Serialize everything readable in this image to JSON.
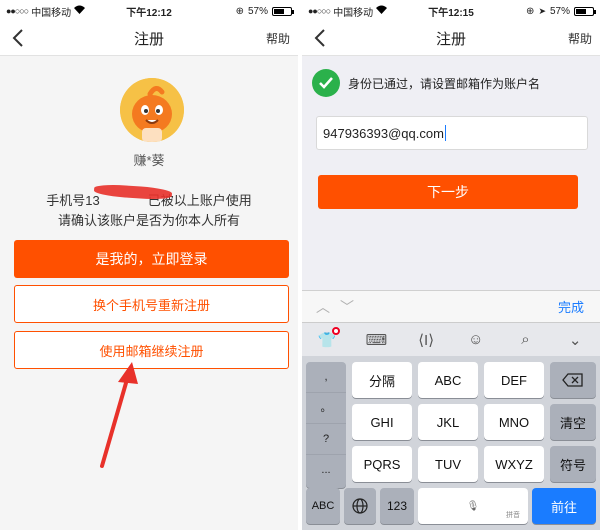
{
  "left": {
    "status": {
      "carrier": "中国移动",
      "time": "下午12:12",
      "battery": "57%",
      "battery_level": 0.57
    },
    "nav": {
      "title": "注册",
      "help": "帮助"
    },
    "nickname": "赚*葵",
    "info_line1_start": "手机号13",
    "info_line1_end": "已被以上账户使用",
    "info_line2": "请确认该账户是否为你本人所有",
    "btn_login": "是我的，立即登录",
    "btn_change_phone": "换个手机号重新注册",
    "btn_use_email": "使用邮箱继续注册"
  },
  "right": {
    "status": {
      "carrier": "中国移动",
      "time": "下午12:15",
      "battery": "57%",
      "battery_level": 0.57
    },
    "nav": {
      "title": "注册",
      "help": "帮助"
    },
    "verified_text": "身份已通过，请设置邮箱作为账户名",
    "email_value": "947936393@qq.com",
    "next_label": "下一步",
    "keyboard": {
      "done": "完成",
      "punctuation": [
        ",",
        "。",
        "?",
        "..."
      ],
      "row1": [
        "分隔",
        "ABC",
        "DEF"
      ],
      "row2": [
        "GHI",
        "JKL",
        "MNO"
      ],
      "row3": [
        "PQRS",
        "TUV",
        "WXYZ"
      ],
      "clear": "清空",
      "symbol": "符号",
      "abc": "ABC",
      "num": "123",
      "space_label": "拼音",
      "go": "前往"
    }
  }
}
